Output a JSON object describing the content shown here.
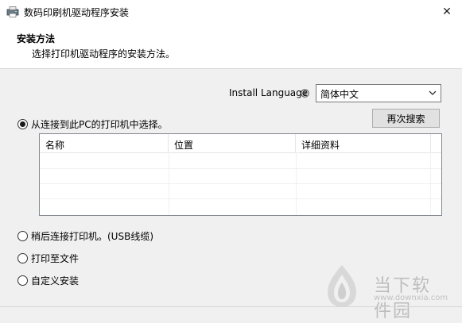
{
  "window": {
    "title": "数码印刷机驱动程序安装",
    "close_glyph": "✕"
  },
  "header": {
    "title": "安装方法",
    "description": "选择打印机驱动程序的安装方法。"
  },
  "language": {
    "label": "Install Language",
    "selected": "简体中文"
  },
  "buttons": {
    "search": "再次搜索"
  },
  "options": [
    {
      "label": "从连接到此PC的打印机中选择。",
      "checked": true
    },
    {
      "label": "稍后连接打印机。(USB线缆)",
      "checked": false
    },
    {
      "label": "打印至文件",
      "checked": false
    },
    {
      "label": "自定义安装",
      "checked": false
    }
  ],
  "table": {
    "columns": [
      "名称",
      "位置",
      "详细资料"
    ],
    "rows": []
  },
  "watermark": {
    "text": "当下软件园",
    "url": "www.downxia.com"
  }
}
